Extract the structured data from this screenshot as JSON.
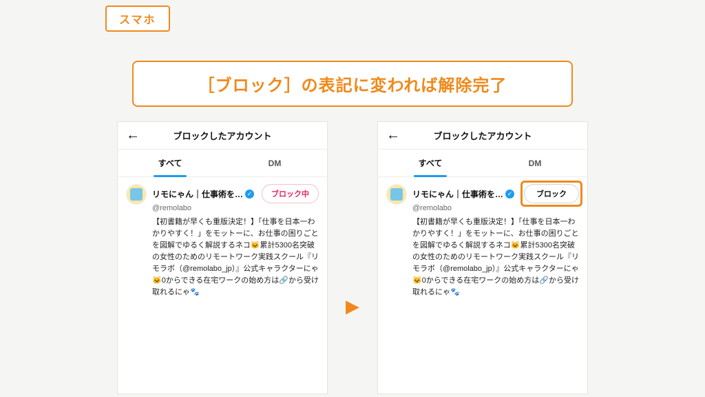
{
  "tag": "スマホ",
  "callout": "［ブロック］の表記に変われば解除完了",
  "arrow": "▶",
  "phone_left": {
    "title": "ブロックしたアカウント",
    "tab_all": "すべて",
    "tab_dm": "DM",
    "account_name": "リモにゃん｜仕事術を…",
    "verified_glyph": "✓",
    "handle": "@remolabo",
    "button": "ブロック中",
    "bio": "【初書籍が早くも重版決定！】「仕事を日本一わかりやすく！」をモットーに、お仕事の困りごとを図解でゆるく解説するネコ🐱累計5300名突破の女性のためのリモートワーク実践スクール『リモラボ（@remolabo_jp）』公式キャラクターにゃ🐱0からできる在宅ワークの始め方は🔗から受け取れるにゃ🐾"
  },
  "phone_right": {
    "title": "ブロックしたアカウント",
    "tab_all": "すべて",
    "tab_dm": "DM",
    "account_name": "リモにゃん｜仕事術を…",
    "verified_glyph": "✓",
    "handle": "@remolabo",
    "button": "ブロック",
    "bio": "【初書籍が早くも重版決定！】「仕事を日本一わかりやすく！」をモットーに、お仕事の困りごとを図解でゆるく解説するネコ🐱累計5300名突破の女性のためのリモートワーク実践スクール『リモラボ（@remolabo_jp）』公式キャラクターにゃ🐱0からできる在宅ワークの始め方は🔗から受け取れるにゃ🐾"
  }
}
